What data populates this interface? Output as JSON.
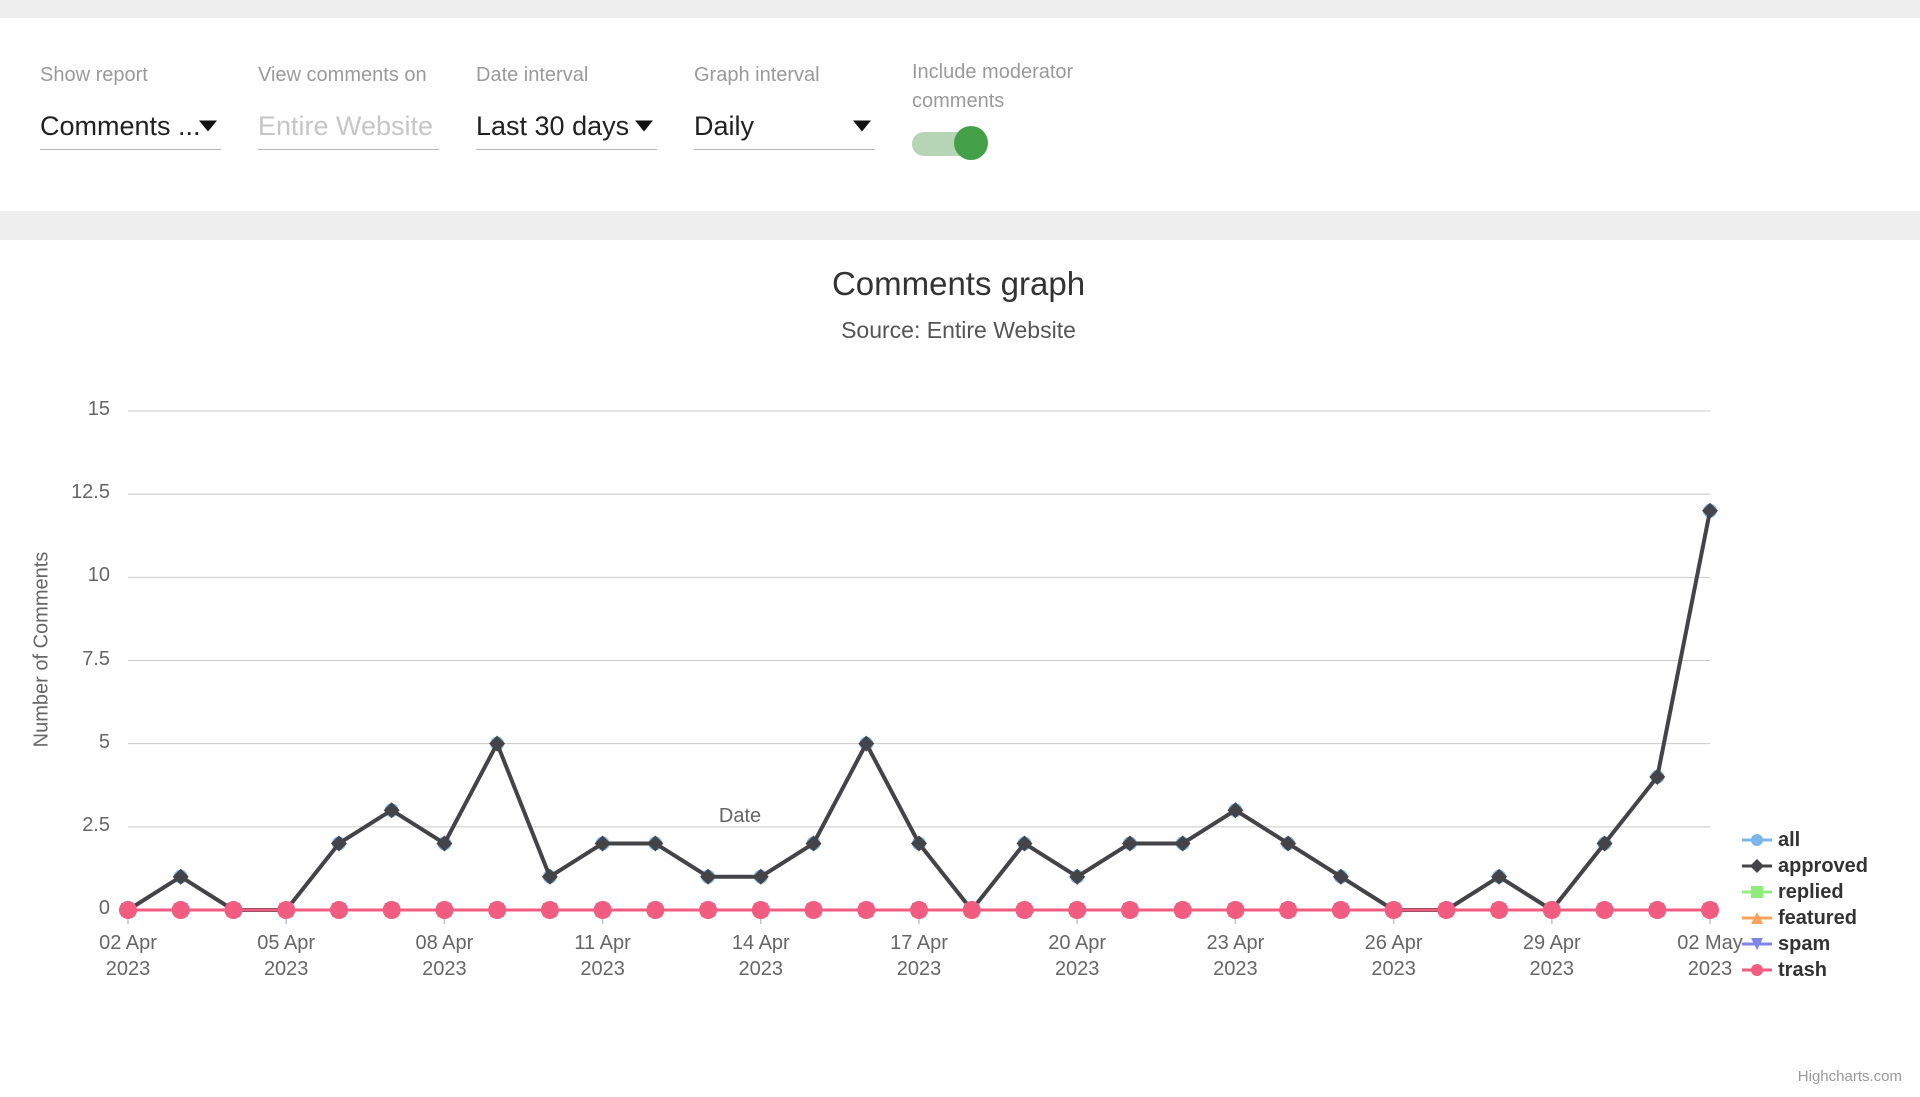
{
  "filters": {
    "show_report": {
      "label": "Show report",
      "value": "Comments ...",
      "icon": "chevron-down-icon"
    },
    "view_comments_on": {
      "label": "View comments on",
      "placeholder": "Entire Website",
      "value": ""
    },
    "date_interval": {
      "label": "Date interval",
      "value": "Last 30 days"
    },
    "graph_interval": {
      "label": "Graph interval",
      "value": "Daily"
    },
    "include_moderator": {
      "label": "Include moderator comments",
      "state": "on",
      "on_color": "#43a047",
      "track_color": "#b6d5b6"
    }
  },
  "chart_credits": "Highcharts.com",
  "chart_data": {
    "type": "line",
    "title": "Comments graph",
    "subtitle": "Source: Entire Website",
    "xlabel": "Date",
    "ylabel": "Number of Comments",
    "ylim": [
      0,
      15
    ],
    "yticks": [
      "0",
      "2.5",
      "5",
      "7.5",
      "10",
      "12.5",
      "15"
    ],
    "ytick_values": [
      0,
      2.5,
      5,
      7.5,
      10,
      12.5,
      15
    ],
    "grid": true,
    "legend_position": "right",
    "xtick_labels": [
      "02 Apr\n2023",
      "05 Apr\n2023",
      "08 Apr\n2023",
      "11 Apr\n2023",
      "14 Apr\n2023",
      "17 Apr\n2023",
      "20 Apr\n2023",
      "23 Apr\n2023",
      "26 Apr\n2023",
      "29 Apr\n2023",
      "02 May\n2023"
    ],
    "xtick_indices": [
      0,
      3,
      6,
      9,
      12,
      15,
      18,
      21,
      24,
      27,
      30
    ],
    "x": [
      "02 Apr 2023",
      "03 Apr 2023",
      "04 Apr 2023",
      "05 Apr 2023",
      "06 Apr 2023",
      "07 Apr 2023",
      "08 Apr 2023",
      "09 Apr 2023",
      "10 Apr 2023",
      "11 Apr 2023",
      "12 Apr 2023",
      "13 Apr 2023",
      "14 Apr 2023",
      "15 Apr 2023",
      "16 Apr 2023",
      "17 Apr 2023",
      "18 Apr 2023",
      "19 Apr 2023",
      "20 Apr 2023",
      "21 Apr 2023",
      "22 Apr 2023",
      "23 Apr 2023",
      "24 Apr 2023",
      "25 Apr 2023",
      "26 Apr 2023",
      "27 Apr 2023",
      "28 Apr 2023",
      "29 Apr 2023",
      "30 Apr 2023",
      "01 May 2023",
      "02 May 2023"
    ],
    "series": [
      {
        "name": "all",
        "color": "#7cb5ec",
        "marker": "circle",
        "values": [
          0,
          1,
          0,
          0,
          2,
          3,
          2,
          5,
          1,
          2,
          2,
          1,
          1,
          2,
          5,
          2,
          0,
          2,
          1,
          2,
          2,
          3,
          2,
          1,
          0,
          0,
          1,
          0,
          2,
          4,
          12
        ]
      },
      {
        "name": "approved",
        "color": "#434348",
        "marker": "diamond",
        "values": [
          0,
          1,
          0,
          0,
          2,
          3,
          2,
          5,
          1,
          2,
          2,
          1,
          1,
          2,
          5,
          2,
          0,
          2,
          1,
          2,
          2,
          3,
          2,
          1,
          0,
          0,
          1,
          0,
          2,
          4,
          12
        ]
      },
      {
        "name": "replied",
        "color": "#90ed7d",
        "marker": "square",
        "values": [
          0,
          0,
          0,
          0,
          0,
          0,
          0,
          0,
          0,
          0,
          0,
          0,
          0,
          0,
          0,
          0,
          0,
          0,
          0,
          0,
          0,
          0,
          0,
          0,
          0,
          0,
          0,
          0,
          0,
          0,
          0
        ]
      },
      {
        "name": "featured",
        "color": "#f7a35c",
        "marker": "triangle",
        "values": [
          0,
          0,
          0,
          0,
          0,
          0,
          0,
          0,
          0,
          0,
          0,
          0,
          0,
          0,
          0,
          0,
          0,
          0,
          0,
          0,
          0,
          0,
          0,
          0,
          0,
          0,
          0,
          0,
          0,
          0,
          0
        ]
      },
      {
        "name": "spam",
        "color": "#8085e9",
        "marker": "triangle-down",
        "values": [
          0,
          0,
          0,
          0,
          0,
          0,
          0,
          0,
          0,
          0,
          0,
          0,
          0,
          0,
          0,
          0,
          0,
          0,
          0,
          0,
          0,
          0,
          0,
          0,
          0,
          0,
          0,
          0,
          0,
          0,
          0
        ]
      },
      {
        "name": "trash",
        "color": "#f15c80",
        "marker": "circle",
        "values": [
          0,
          0,
          0,
          0,
          0,
          0,
          0,
          0,
          0,
          0,
          0,
          0,
          0,
          0,
          0,
          0,
          0,
          0,
          0,
          0,
          0,
          0,
          0,
          0,
          0,
          0,
          0,
          0,
          0,
          0,
          0
        ]
      }
    ]
  }
}
